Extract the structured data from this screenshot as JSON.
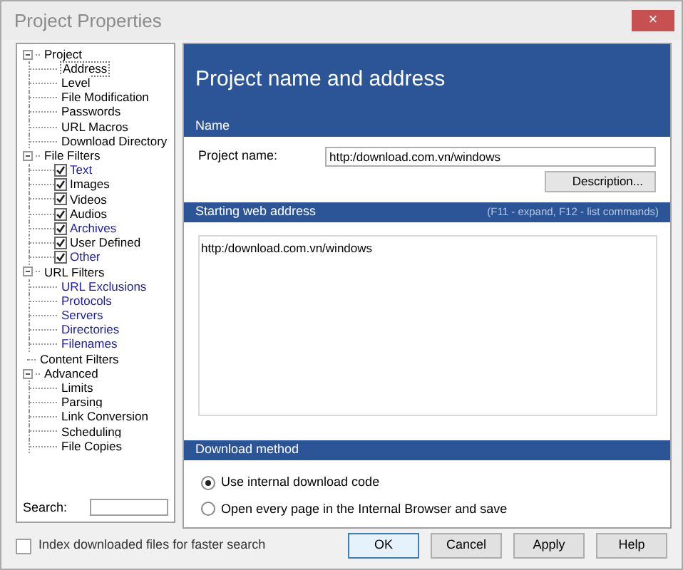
{
  "window": {
    "title": "Project Properties",
    "close": "×"
  },
  "tree": [
    {
      "label": "Project",
      "expanded": true,
      "selected": false,
      "color": "#000000",
      "children": [
        {
          "label": "Address",
          "kind": "plain",
          "selected": true,
          "color": "#000000"
        },
        {
          "label": "Level",
          "kind": "plain",
          "selected": false,
          "color": "#000000"
        },
        {
          "label": "File Modification",
          "kind": "plain",
          "selected": false,
          "color": "#000000"
        },
        {
          "label": "Passwords",
          "kind": "plain",
          "selected": false,
          "color": "#000000"
        },
        {
          "label": "URL Macros",
          "kind": "plain",
          "selected": false,
          "color": "#000000"
        },
        {
          "label": "Download Directory",
          "kind": "plain",
          "selected": false,
          "color": "#000000"
        }
      ]
    },
    {
      "label": "File Filters",
      "expanded": true,
      "selected": false,
      "color": "#000000",
      "children": [
        {
          "label": "Text",
          "kind": "check",
          "checked": true,
          "selected": false,
          "color": "#1c1ca8"
        },
        {
          "label": "Images",
          "kind": "check",
          "checked": true,
          "selected": false,
          "color": "#000000"
        },
        {
          "label": "Videos",
          "kind": "check",
          "checked": true,
          "selected": false,
          "color": "#000000"
        },
        {
          "label": "Audios",
          "kind": "check",
          "checked": true,
          "selected": false,
          "color": "#000000"
        },
        {
          "label": "Archives",
          "kind": "check",
          "checked": true,
          "selected": false,
          "color": "#1c1ca8"
        },
        {
          "label": "User Defined",
          "kind": "check",
          "checked": true,
          "selected": false,
          "color": "#000000"
        },
        {
          "label": "Other",
          "kind": "check",
          "checked": true,
          "selected": false,
          "color": "#1c1ca8"
        }
      ]
    },
    {
      "label": "URL Filters",
      "expanded": true,
      "selected": false,
      "color": "#000000",
      "children": [
        {
          "label": "URL Exclusions",
          "kind": "plain",
          "selected": false,
          "color": "#1c1ca8"
        },
        {
          "label": "Protocols",
          "kind": "plain",
          "selected": false,
          "color": "#1c1ca8"
        },
        {
          "label": "Servers",
          "kind": "plain",
          "selected": false,
          "color": "#1c1ca8"
        },
        {
          "label": "Directories",
          "kind": "plain",
          "selected": false,
          "color": "#1c1ca8"
        },
        {
          "label": "Filenames",
          "kind": "plain",
          "selected": false,
          "color": "#1c1ca8"
        }
      ]
    },
    {
      "label": "Content Filters",
      "selected": false,
      "color": "#000000"
    },
    {
      "label": "Advanced",
      "expanded": true,
      "selected": false,
      "color": "#000000",
      "children": [
        {
          "label": "Limits",
          "kind": "plain",
          "selected": false,
          "color": "#000000"
        },
        {
          "label": "Parsing",
          "kind": "plain",
          "selected": false,
          "color": "#000000"
        },
        {
          "label": "Link Conversion",
          "kind": "plain",
          "selected": false,
          "color": "#000000"
        },
        {
          "label": "Scheduling",
          "kind": "plain",
          "selected": false,
          "color": "#000000"
        },
        {
          "label": "File Copies",
          "kind": "plain",
          "selected": false,
          "color": "#000000"
        }
      ]
    }
  ],
  "search": {
    "label": "Search:"
  },
  "index_option": {
    "label": "Index downloaded files for faster search",
    "checked": false
  },
  "panel": {
    "title": "Project name and address",
    "name_section": {
      "heading": "Name",
      "project_name_label": "Project name:",
      "project_name_value": "http:/download.com.vn/windows",
      "description_button": "Description..."
    },
    "address_section": {
      "heading": "Starting web address",
      "hint": "(F11 - expand, F12 - list commands)",
      "value": "http:/download.com.vn/windows"
    },
    "method_section": {
      "heading": "Download method",
      "options": [
        {
          "label": "Use internal download code",
          "selected": true
        },
        {
          "label": "Open every page in the Internal Browser and save",
          "selected": false
        }
      ]
    }
  },
  "buttons": [
    {
      "label": "OK",
      "default": true
    },
    {
      "label": "Cancel",
      "default": false
    },
    {
      "label": "Apply",
      "default": false
    },
    {
      "label": "Help",
      "default": false
    }
  ]
}
